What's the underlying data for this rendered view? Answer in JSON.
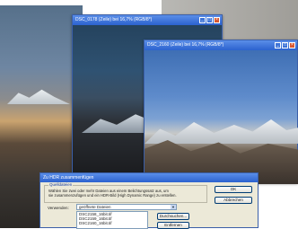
{
  "window_back": {
    "title": "DSC_0178 (Zeile) bei 16,7% (RGB/8*)",
    "buttons": [
      "_",
      "□",
      "×"
    ]
  },
  "window_front": {
    "title": "DSC_2160 (Zeile) bei 16,7% (RGB/8*)",
    "buttons": [
      "_",
      "□",
      "×"
    ]
  },
  "dialog": {
    "title": "Zu HDR zusammenfügen",
    "group_legend": "Quelldateien",
    "group_text": [
      "Wählen Sie zwei oder mehr Dateien aus einem Belichtungssatz aus, um",
      "sie zusammenzufügen und ein HDR-Bild (High Dynamic Range) zu erstellen."
    ],
    "use_label": "Verwenden:",
    "use_value": "geöffnete Dateien",
    "files": [
      "DSC2158_16bit.tif",
      "DSC2159_16bit.tif",
      "DSC2160_16bit.tif"
    ],
    "ok_label": "OK",
    "cancel_label": "Abbrechen",
    "browse_label": "Durchsuchen...",
    "remove_label": "Entfernen"
  }
}
